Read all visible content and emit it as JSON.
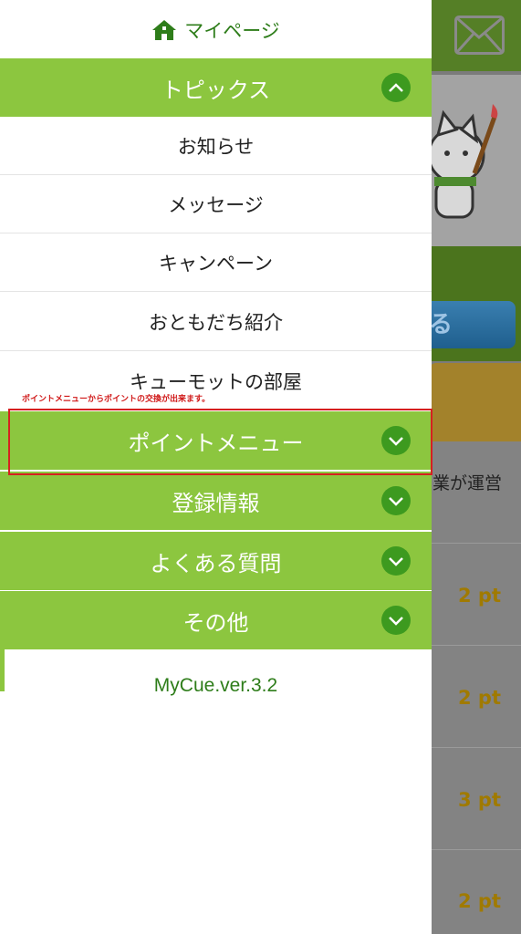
{
  "header": {
    "mypage_label": "マイページ"
  },
  "menu": {
    "topics": {
      "label": "トピックス",
      "items": [
        "お知らせ",
        "メッセージ",
        "キャンペーン",
        "おともだち紹介",
        "キューモットの部屋"
      ]
    },
    "point_menu": {
      "label": "ポイントメニュー"
    },
    "registration": {
      "label": "登録情報"
    },
    "faq": {
      "label": "よくある質問"
    },
    "others": {
      "label": "その他"
    }
  },
  "annotation": {
    "text": "ポイントメニューからポイントの交換が出来ます。"
  },
  "version": "MyCue.ver.3.2",
  "background": {
    "button_partial": "る",
    "snippet": "業が運営",
    "points": [
      "2 pt",
      "2 pt",
      "3 pt",
      "2 pt"
    ]
  },
  "colors": {
    "menu_green": "#8cc63f",
    "chevron_green": "#3d9a1f",
    "text_green": "#2e7d1a",
    "highlight_red": "#d62020"
  },
  "icons": {
    "home": "home-icon",
    "collapse": "chevron-up-icon",
    "expand": "chevron-down-icon",
    "mail": "mail-icon"
  }
}
